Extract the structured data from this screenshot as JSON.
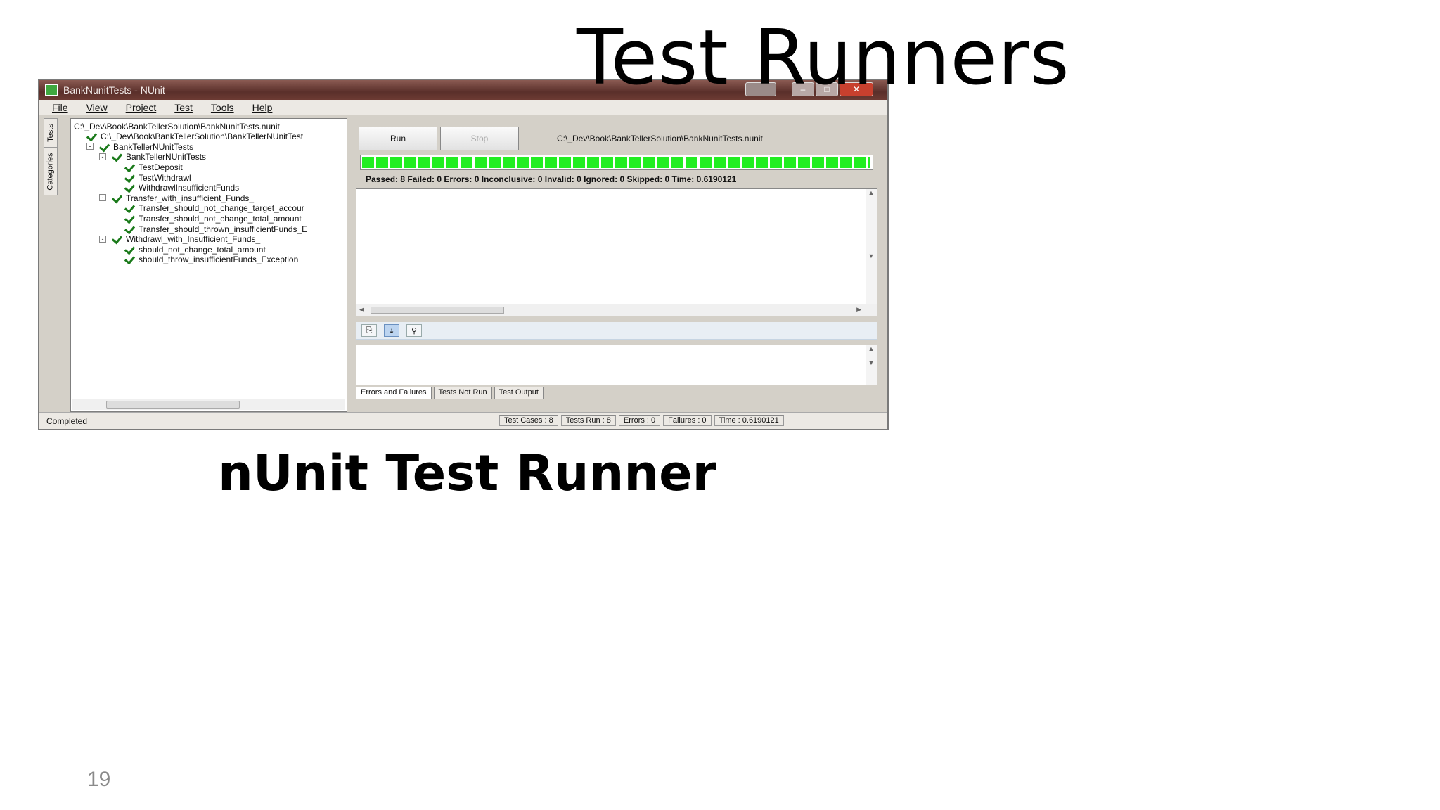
{
  "slide": {
    "title": "Test Runners",
    "caption": "nUnit Test Runner",
    "page_number": "19"
  },
  "window": {
    "title": "BankNunitTests - NUnit",
    "menu": [
      "File",
      "View",
      "Project",
      "Test",
      "Tools",
      "Help"
    ],
    "side_tabs": [
      "Tests",
      "Categories"
    ],
    "tree": [
      {
        "label": "C:\\_Dev\\Book\\BankTellerSolution\\BankNunitTests.nunit",
        "indent": 0,
        "check": false
      },
      {
        "label": "C:\\_Dev\\Book\\BankTellerSolution\\BankTellerNUnitTest",
        "indent": 1,
        "check": true
      },
      {
        "label": "BankTellerNUnitTests",
        "indent": 2,
        "check": true,
        "expander": "-"
      },
      {
        "label": "BankTellerNUnitTests",
        "indent": 3,
        "check": true,
        "expander": "-"
      },
      {
        "label": "TestDeposit",
        "indent": 4,
        "check": true
      },
      {
        "label": "TestWithdrawl",
        "indent": 4,
        "check": true
      },
      {
        "label": "WithdrawlInsufficientFunds",
        "indent": 4,
        "check": true
      },
      {
        "label": "Transfer_with_insufficient_Funds_",
        "indent": 3,
        "check": true,
        "expander": "-"
      },
      {
        "label": "Transfer_should_not_change_target_accour",
        "indent": 4,
        "check": true
      },
      {
        "label": "Transfer_should_not_change_total_amount",
        "indent": 4,
        "check": true
      },
      {
        "label": "Transfer_should_thrown_insufficientFunds_E",
        "indent": 4,
        "check": true
      },
      {
        "label": "Withdrawl_with_Insufficient_Funds_",
        "indent": 3,
        "check": true,
        "expander": "-"
      },
      {
        "label": "should_not_change_total_amount",
        "indent": 4,
        "check": true
      },
      {
        "label": "should_throw_insufficientFunds_Exception",
        "indent": 4,
        "check": true
      }
    ],
    "buttons": {
      "run": "Run",
      "stop": "Stop"
    },
    "project_path": "C:\\_Dev\\Book\\BankTellerSolution\\BankNunitTests.nunit",
    "progress": {
      "fraction": 1.0,
      "color": "#22ee22"
    },
    "summary": "Passed: 8  Failed: 0  Errors: 0  Inconclusive: 0  Invalid: 0  Ignored: 0  Skipped: 0  Time: 0.6190121",
    "bottom_tabs": [
      "Errors and Failures",
      "Tests Not Run",
      "Test Output"
    ],
    "status": {
      "left": "Completed",
      "cells": [
        "Test Cases : 8",
        "Tests Run : 8",
        "Errors : 0",
        "Failures : 0",
        "Time : 0.6190121"
      ]
    }
  }
}
